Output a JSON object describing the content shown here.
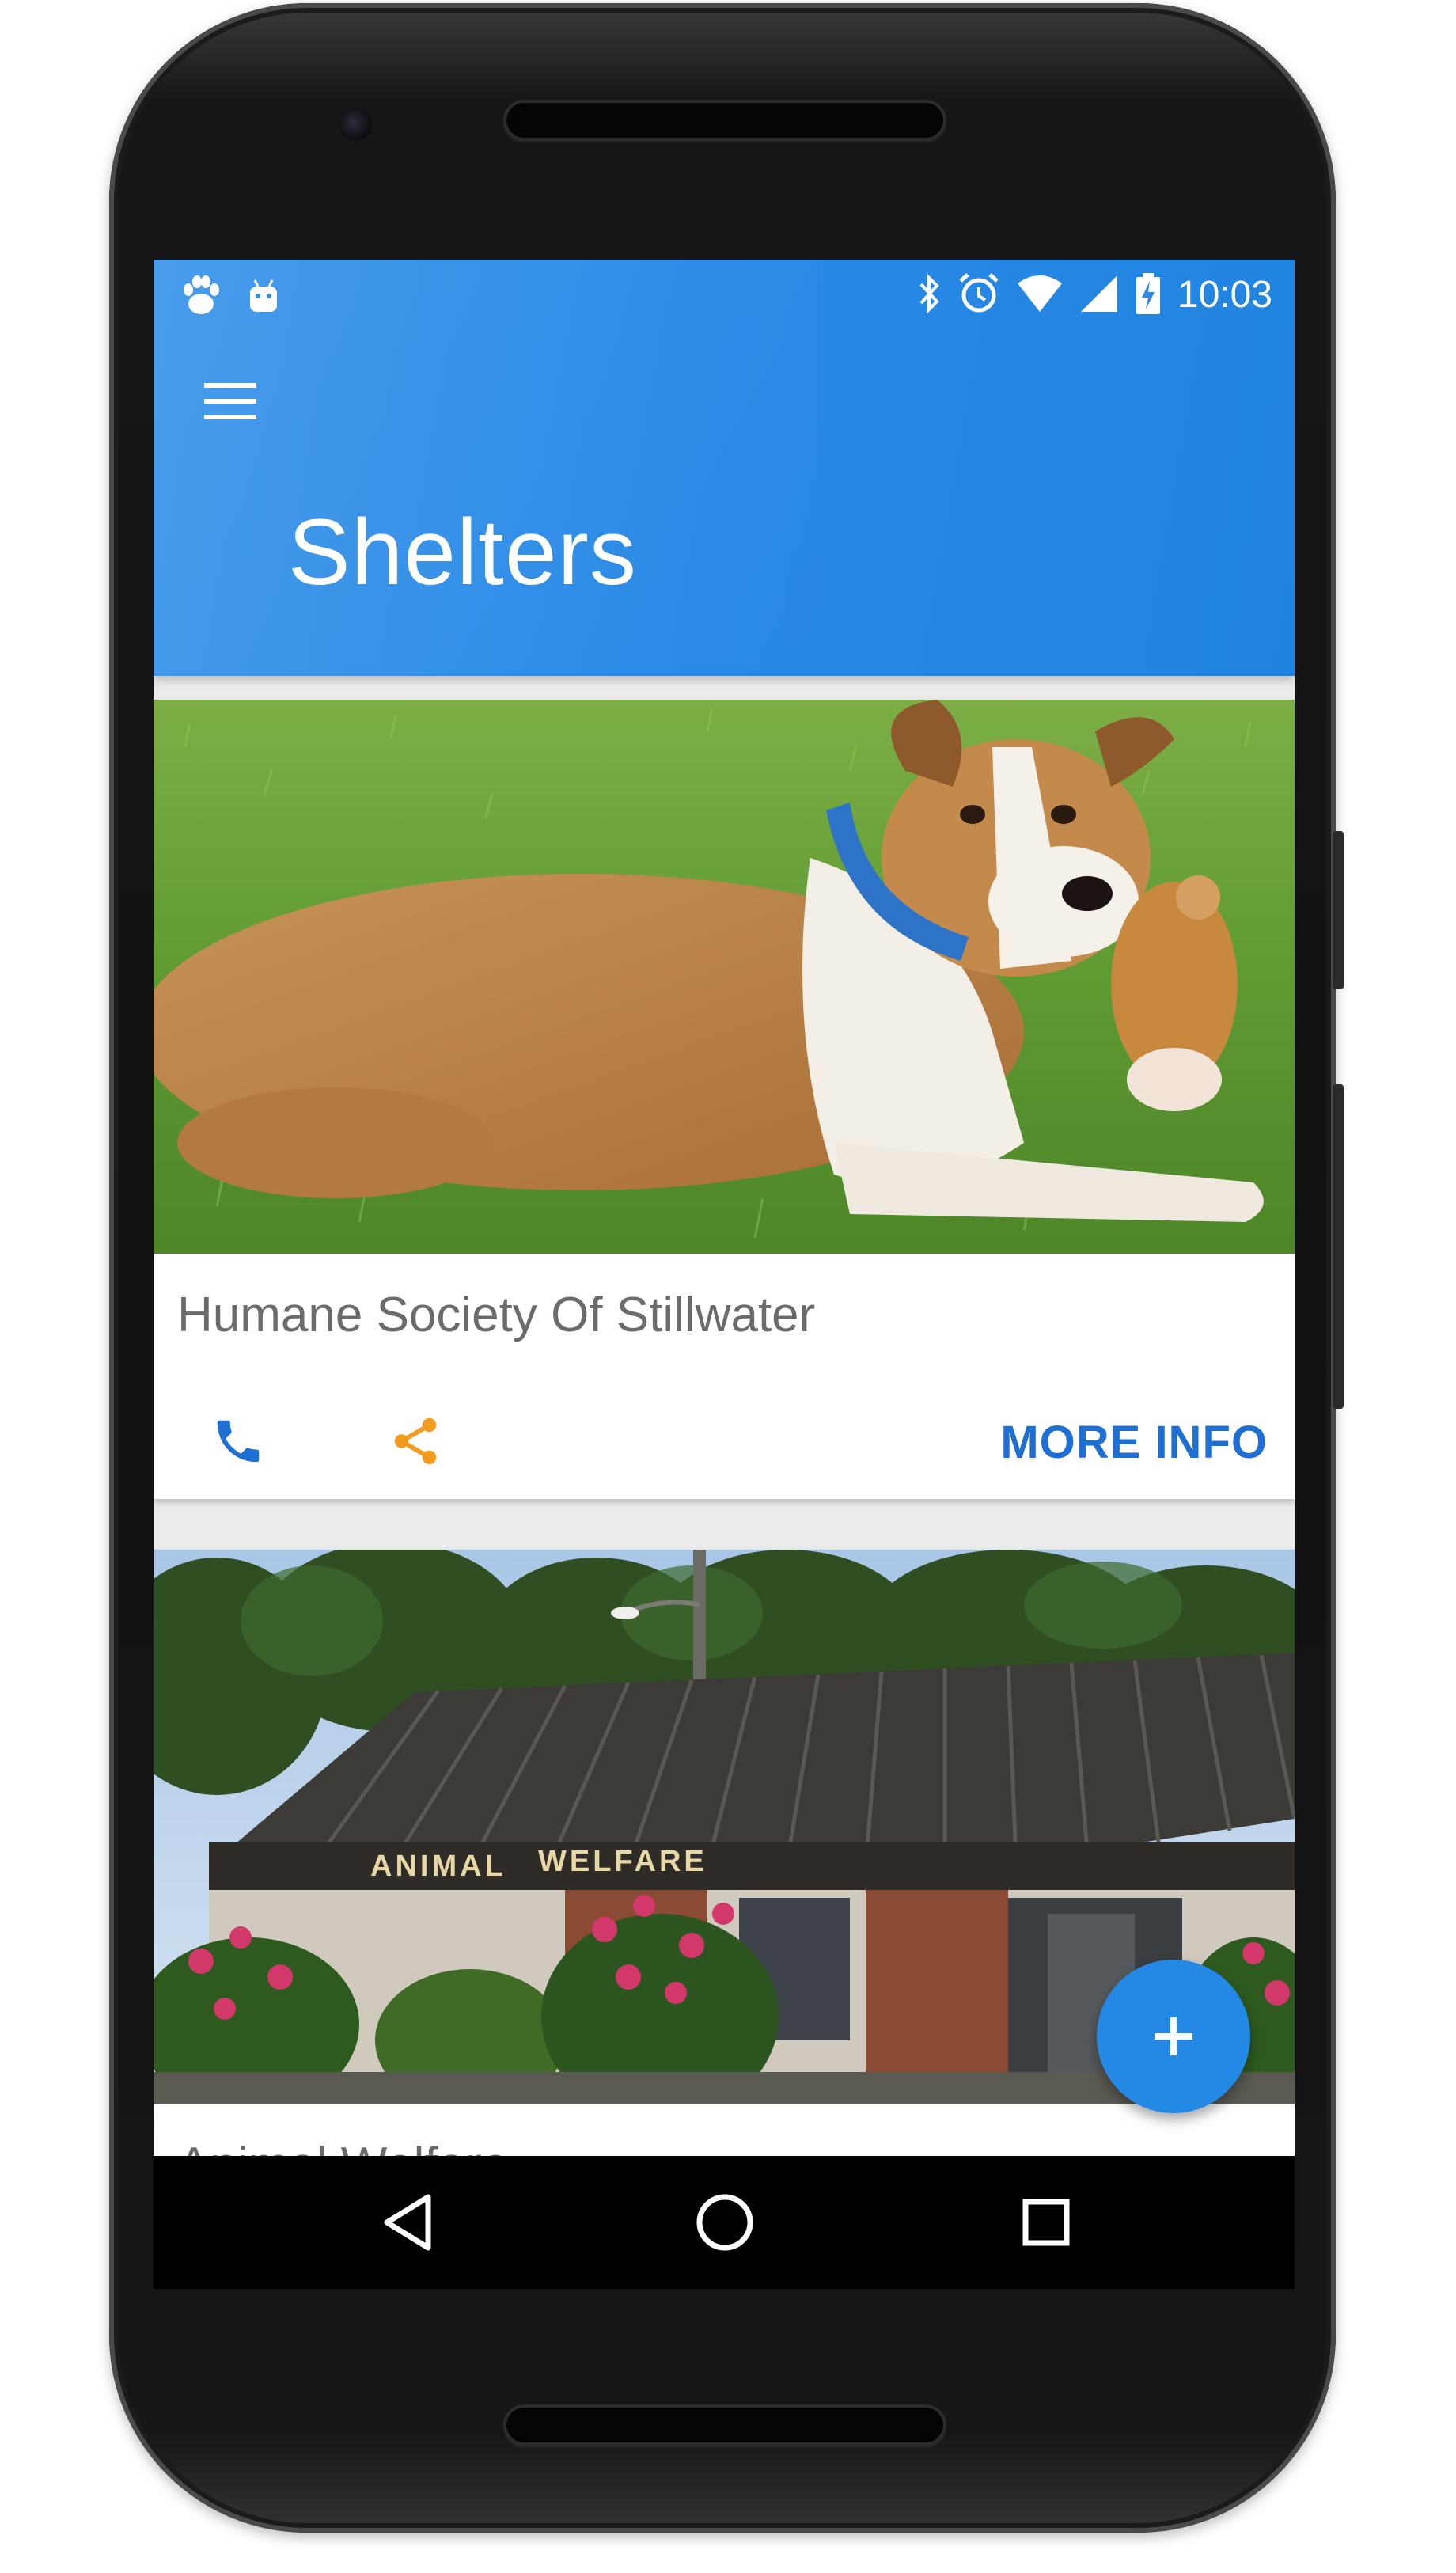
{
  "status_bar": {
    "time": "10:03",
    "left_icons": [
      "paw-icon",
      "android-icon"
    ],
    "right_icons": [
      "bluetooth-icon",
      "alarm-icon",
      "wifi-icon",
      "cell-signal-icon",
      "battery-charging-icon"
    ]
  },
  "app_bar": {
    "title": "Shelters",
    "menu_icon": "hamburger-menu-icon",
    "color": "#2a8ae6"
  },
  "shelters": [
    {
      "name": "Humane Society Of Stillwater",
      "photo": "dog-on-grass-photo",
      "actions": {
        "call_icon": "phone-icon",
        "share_icon": "share-icon",
        "more_label": "MORE INFO"
      }
    },
    {
      "name": "Animal Welfare",
      "photo": "animal-welfare-building-photo",
      "sign_text": "ANIMAL WELFARE"
    }
  ],
  "fab": {
    "icon": "plus-icon",
    "color": "#2489e4"
  },
  "nav_bar": {
    "icons": [
      "back-icon",
      "home-icon",
      "recents-icon"
    ]
  },
  "colors": {
    "accent": "#1e6fd4",
    "share": "#f39b1e",
    "primary": "#2a8ae6"
  }
}
